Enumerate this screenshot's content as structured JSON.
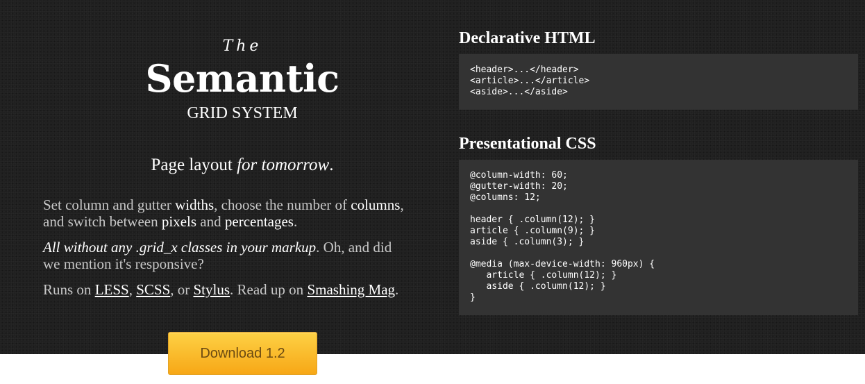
{
  "logo": {
    "the": "The",
    "semantic": "Semantic",
    "grid_system": "GRID SYSTEM"
  },
  "tagline": {
    "plain": "Page layout ",
    "italic": "for tomorrow",
    "end": "."
  },
  "paragraph1": {
    "a": "Set column and gutter ",
    "b": "widths",
    "c": ", choose the number of ",
    "d": "columns",
    "e": ",",
    "f": "and switch between ",
    "g": "pixels",
    "h": " and ",
    "i": "percentages",
    "j": "."
  },
  "paragraph2": {
    "italic": "All without any .grid_x classes in your markup",
    "rest": ". Oh, and did",
    "line2": "we mention it's responsive?"
  },
  "paragraph3": {
    "a": "Runs on ",
    "less": "LESS",
    "b": ", ",
    "scss": "SCSS",
    "c": ", or ",
    "stylus": "Stylus",
    "d": ". Read up on ",
    "smashing": "Smashing Mag",
    "e": "."
  },
  "download": {
    "label": "Download 1.2"
  },
  "declarative": {
    "title": "Declarative HTML",
    "code": "<header>...</header>\n<article>...</article>\n<aside>...</aside>"
  },
  "presentational": {
    "title": "Presentational CSS",
    "code": "@column-width: 60;\n@gutter-width: 20;\n@columns: 12;\n\nheader { .column(12); }\narticle { .column(9); }\naside { .column(3); }\n\n@media (max-device-width: 960px) {\n   article { .column(12); }\n   aside { .column(12); }\n}"
  }
}
